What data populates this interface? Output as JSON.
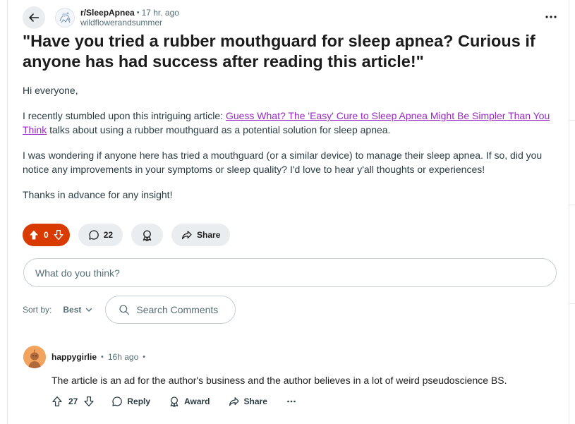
{
  "post": {
    "subreddit": "r/SleepApnea",
    "time": "17 hr. ago",
    "author": "wildflowerandsummer",
    "title": "\"Have you tried a rubber mouthguard for sleep apnea? Curious if anyone has had success after reading this article!\"",
    "greeting": "Hi everyone,",
    "para1_before": "I recently stumbled upon this intriguing article: ",
    "para1_link": "Guess What? The 'Easy' Cure to Sleep Apnea Might Be Simpler Than You Think",
    "para1_after": " talks about using a rubber mouthguard as a potential solution for sleep apnea.",
    "para2": "I was wondering if anyone here has tried a mouthguard (or a similar device) to manage their sleep apnea. If so, did you notice any improvements in your symptoms or sleep quality? I'd love to hear y'all thoughts or experiences!",
    "para3": "Thanks in advance for any insight!"
  },
  "actions": {
    "votes": "0",
    "comments": "22",
    "share": "Share"
  },
  "comment_box": {
    "placeholder": "What do you think?"
  },
  "sort": {
    "label": "Sort by:",
    "value": "Best",
    "search_placeholder": "Search Comments"
  },
  "comment": {
    "user": "happygirlie",
    "time": "16h ago",
    "text": "The article is an ad for the author's business and the author believes in a lot of weird pseudoscience BS.",
    "votes": "27",
    "reply": "Reply",
    "award": "Award",
    "share": "Share"
  },
  "colors": {
    "upvote_active": "#d93a00",
    "link": "#9b27c7",
    "pill_bg": "#eaedef",
    "muted_text": "#576f76"
  },
  "icons": [
    "back-arrow-icon",
    "subreddit-avatar-icon",
    "more-icon",
    "upvote-icon",
    "downvote-icon",
    "comment-icon",
    "award-icon",
    "share-icon",
    "chevron-down-icon",
    "search-icon",
    "user-avatar-icon",
    "reply-icon"
  ]
}
